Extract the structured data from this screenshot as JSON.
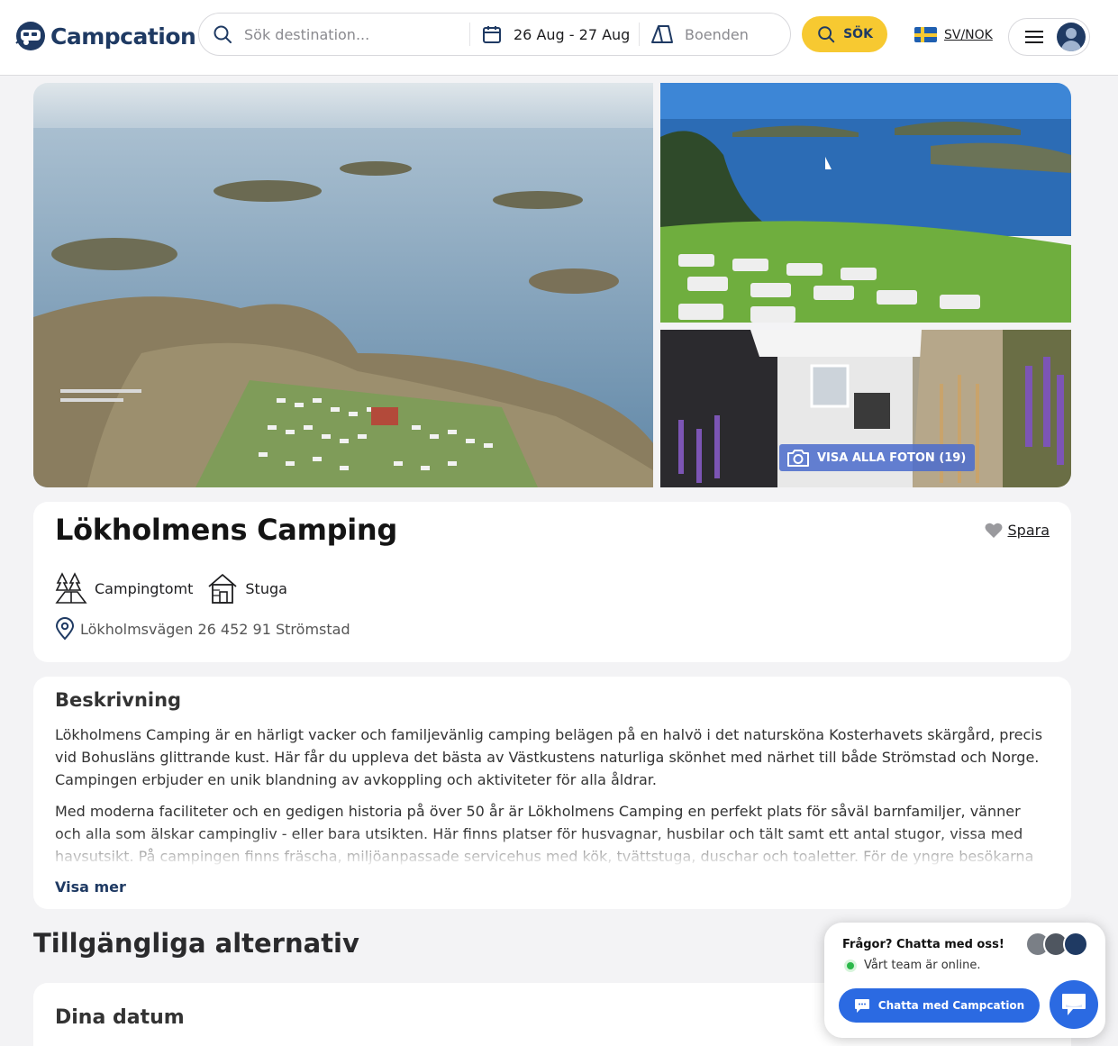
{
  "header": {
    "logo_text": "Campcation",
    "search": {
      "destination_placeholder": "Sök destination...",
      "dates": "26 Aug - 27 Aug",
      "accommodation_placeholder": "Boenden"
    },
    "search_button": "SÖK",
    "locale": "SV/NOK"
  },
  "gallery": {
    "all_photos_label": "VISA ALLA FOTON (19)"
  },
  "listing": {
    "title": "Lökholmens Camping",
    "save_label": "Spara",
    "types": [
      {
        "label": "Campingtomt",
        "icon": "campsite-icon"
      },
      {
        "label": "Stuga",
        "icon": "cabin-icon"
      }
    ],
    "address": "Lökholmsvägen 26 452 91 Strömstad"
  },
  "description": {
    "heading": "Beskrivning",
    "paragraphs": [
      "Lökholmens Camping är en härligt vacker och familjevänlig camping belägen på en halvö i det natursköna Kosterhavets skärgård, precis vid Bohusläns glittrande kust. Här får du uppleva det bästa av Västkustens naturliga skönhet med närhet till både Strömstad och Norge. Campingen erbjuder en unik blandning av avkoppling och aktiviteter för alla åldrar.",
      "Med moderna faciliteter och en gedigen historia på över 50 år är Lökholmens Camping en perfekt plats för såväl barnfamiljer, vänner och alla som älskar campingliv - eller bara utsikten. Här finns platser för husvagnar, husbilar och tält samt ett antal stugor, vissa med havsutsikt. På campingen finns fräscha, miljöanpassade servicehus med kök, tvättstuga, duschar och toaletter. För de yngre besökarna"
    ],
    "show_more": "Visa mer"
  },
  "options": {
    "heading": "Tillgängliga alternativ",
    "dates_heading": "Dina datum"
  },
  "chat": {
    "question": "Frågor? Chatta med oss!",
    "online": "Vårt team är online.",
    "button": "Chatta med Campcation",
    "accent": "#2b6ae2",
    "online_color": "#2bb84a"
  },
  "colors": {
    "brand": "#1f3a63",
    "search_button": "#f7c931"
  }
}
